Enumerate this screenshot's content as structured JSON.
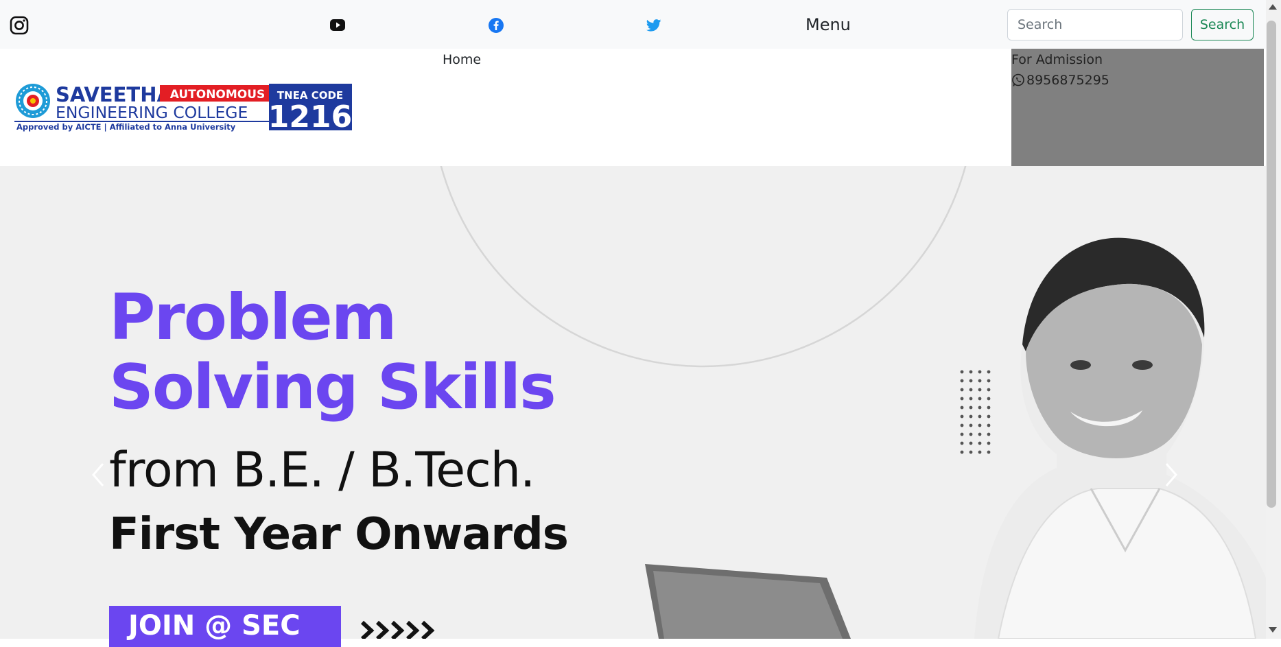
{
  "topbar": {
    "menu_label": "Menu",
    "search_placeholder": "Search",
    "search_button": "Search",
    "social": [
      "instagram-icon",
      "youtube-icon",
      "facebook-icon",
      "twitter-icon"
    ]
  },
  "nav": {
    "home_label": "Home"
  },
  "admission": {
    "label": "For Admission",
    "phone": "8956875295"
  },
  "logo": {
    "name_line1": "SAVEETHA",
    "badge": "AUTONOMOUS",
    "name_line2": "ENGINEERING COLLEGE",
    "subline": "Approved by AICTE  |  Affiliated to Anna University",
    "code_label": "TNEA CODE",
    "code_value": "1216"
  },
  "hero": {
    "line1": "Problem",
    "line2": "Solving Skills",
    "line3": "from B.E. / B.Tech.",
    "line4": "First Year Onwards",
    "cta": "JOIN @ SEC",
    "chevrons": "›››››"
  },
  "colors": {
    "accent_purple": "#6b46f0",
    "button_green": "#198754",
    "logo_blue": "#1e3a9e",
    "logo_red": "#e31e24",
    "admission_bg": "#808080"
  }
}
